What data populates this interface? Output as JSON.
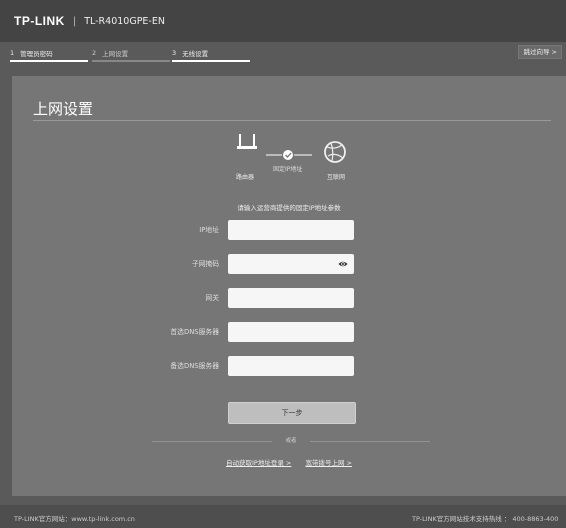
{
  "header": {
    "logo": "TP-LINK",
    "separator": "|",
    "model": "TL-R4010GPE-EN"
  },
  "wizard": {
    "steps": [
      {
        "num": "1",
        "label": "管理员密码",
        "state": "done"
      },
      {
        "num": "2",
        "label": "上网设置",
        "state": "active"
      },
      {
        "num": "3",
        "label": "无线设置",
        "state": "done"
      }
    ],
    "skip_label": "跳过向导 >"
  },
  "page": {
    "title": "上网设置"
  },
  "diagram": {
    "router_label": "路由器",
    "connection_label": "固定IP地址",
    "internet_label": "互联网",
    "router_icon": "router-icon",
    "check_icon": "check-circle-icon",
    "globe_icon": "globe-icon"
  },
  "form": {
    "hint": "请输入运营商提供的固定IP地址参数",
    "fields": [
      {
        "label": "IP地址",
        "value": ""
      },
      {
        "label": "子网掩码",
        "value": ""
      },
      {
        "label": "网关",
        "value": ""
      },
      {
        "label": "首选DNS服务器",
        "value": ""
      },
      {
        "label": "备选DNS服务器",
        "value": ""
      }
    ],
    "next_label": "下一步",
    "or_label": "或者",
    "links": [
      {
        "label": "自动获取IP地址登录 >"
      },
      {
        "label": "宽带拨号上网 >"
      }
    ]
  },
  "footer": {
    "website": "TP-LINK官方网站：www.tp-link.com.cn",
    "hotline": "TP-LINK官方网站技术支持热线 ： 400-8863-400"
  },
  "colors": {
    "page_bg": "#5a5a5a",
    "panel_bg": "#767676",
    "header_bg": "#444444",
    "input_bg": "#f6f6f6"
  }
}
